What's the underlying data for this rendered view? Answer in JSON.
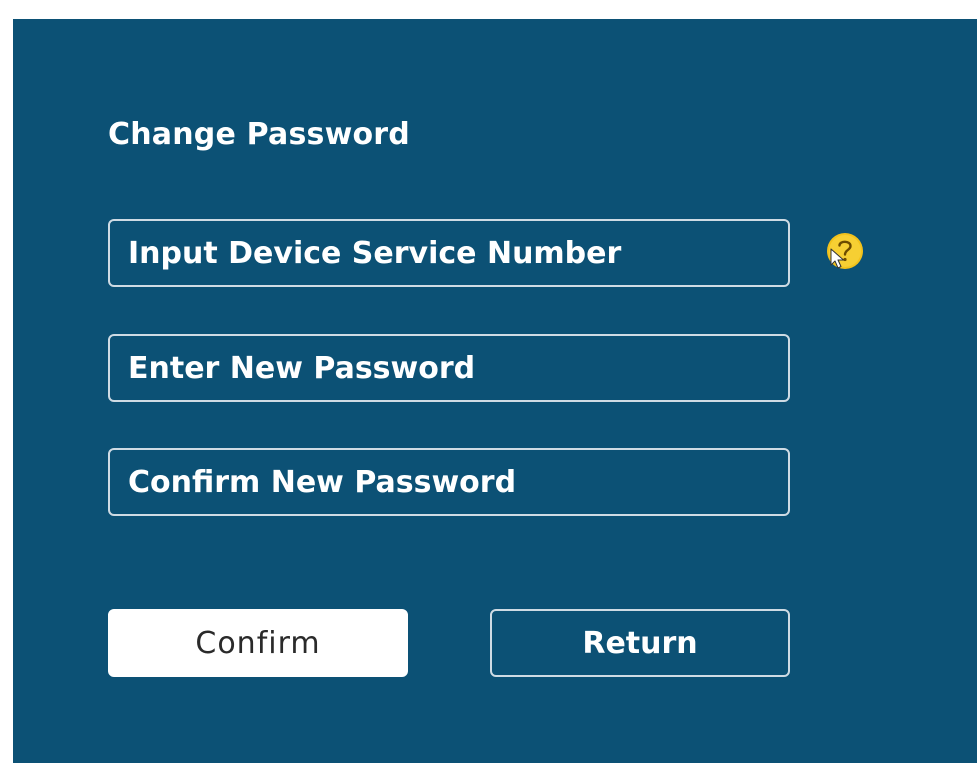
{
  "dialog": {
    "title": "Change Password",
    "fields": {
      "service_number_placeholder": "Input Device Service Number",
      "new_password_placeholder": "Enter New Password",
      "confirm_password_placeholder": "Confirm New Password"
    },
    "help_icon": "question-mark-icon",
    "buttons": {
      "confirm_label": "Confirm",
      "return_label": "Return"
    }
  },
  "colors": {
    "panel_background": "#0c5175",
    "help_icon": "#f2c21b",
    "field_border": "#cfdbe4",
    "text": "#ffffff"
  }
}
